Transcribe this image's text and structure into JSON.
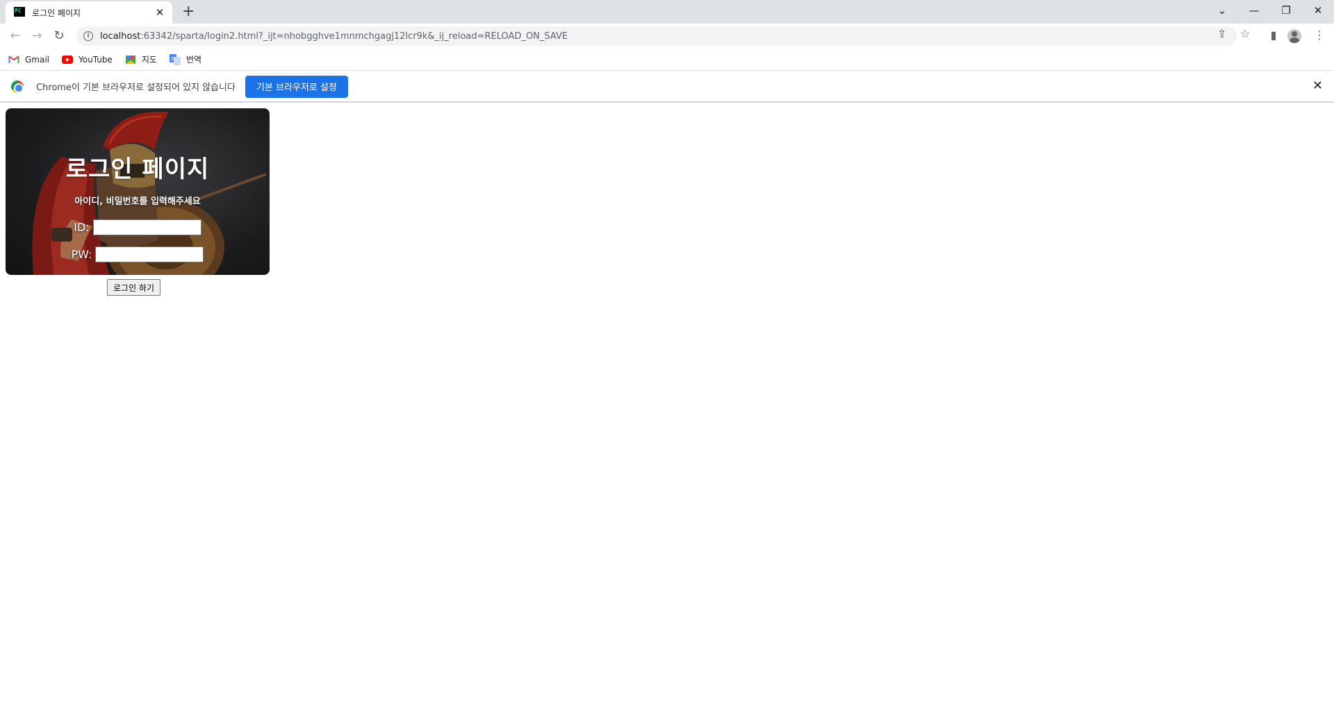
{
  "tab": {
    "title": "로그인 페이지",
    "favicon_text": "PC"
  },
  "toolbar": {
    "url_host": "localhost",
    "url_rest": ":63342/sparta/login2.html?_ijt=nhobgghve1mnmchgagj12lcr9k&_ij_reload=RELOAD_ON_SAVE"
  },
  "bookmarks": [
    {
      "label": "Gmail",
      "icon": "gmail-icon"
    },
    {
      "label": "YouTube",
      "icon": "youtube-icon"
    },
    {
      "label": "지도",
      "icon": "maps-icon"
    },
    {
      "label": "번역",
      "icon": "translate-icon"
    }
  ],
  "infobar": {
    "message": "Chrome이 기본 브라우저로 설정되어 있지 않습니다",
    "button": "기본 브라우저로 설정"
  },
  "login": {
    "title": "로그인 페이지",
    "subtitle": "아이디, 비밀번호를 입력해주세요",
    "id_label": "ID:",
    "pw_label": "PW:",
    "id_value": "",
    "pw_value": "",
    "button": "로그인 하기"
  },
  "colors": {
    "accent": "#1a73e8",
    "tabstrip": "#dee1e6"
  }
}
